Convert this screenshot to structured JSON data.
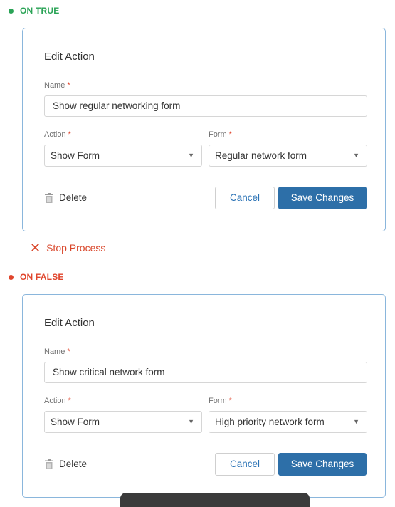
{
  "branches": {
    "true": {
      "heading": "ON TRUE",
      "color": "#2aa356",
      "card": {
        "title": "Edit Action",
        "name_label": "Name",
        "name_value": "Show regular networking form",
        "action_label": "Action",
        "action_value": "Show Form",
        "form_label": "Form",
        "form_value": "Regular network form",
        "required_mark": "*",
        "delete_label": "Delete",
        "cancel_label": "Cancel",
        "save_label": "Save Changes"
      }
    },
    "stop": {
      "icon": "✕",
      "label": "Stop Process"
    },
    "false": {
      "heading": "ON FALSE",
      "color": "#e0452c",
      "card": {
        "title": "Edit Action",
        "name_label": "Name",
        "name_value": "Show critical network form",
        "action_label": "Action",
        "action_value": "Show Form",
        "form_label": "Form",
        "form_value": "High priority network form",
        "required_mark": "*",
        "delete_label": "Delete",
        "cancel_label": "Cancel",
        "save_label": "Save Changes"
      }
    }
  },
  "icons": {
    "caret": "▼",
    "trash": "trash-icon",
    "stop": "close-icon"
  },
  "colors": {
    "accent": "#2d6fa8",
    "card_border": "#8ab6dc",
    "danger": "#d9462a"
  }
}
